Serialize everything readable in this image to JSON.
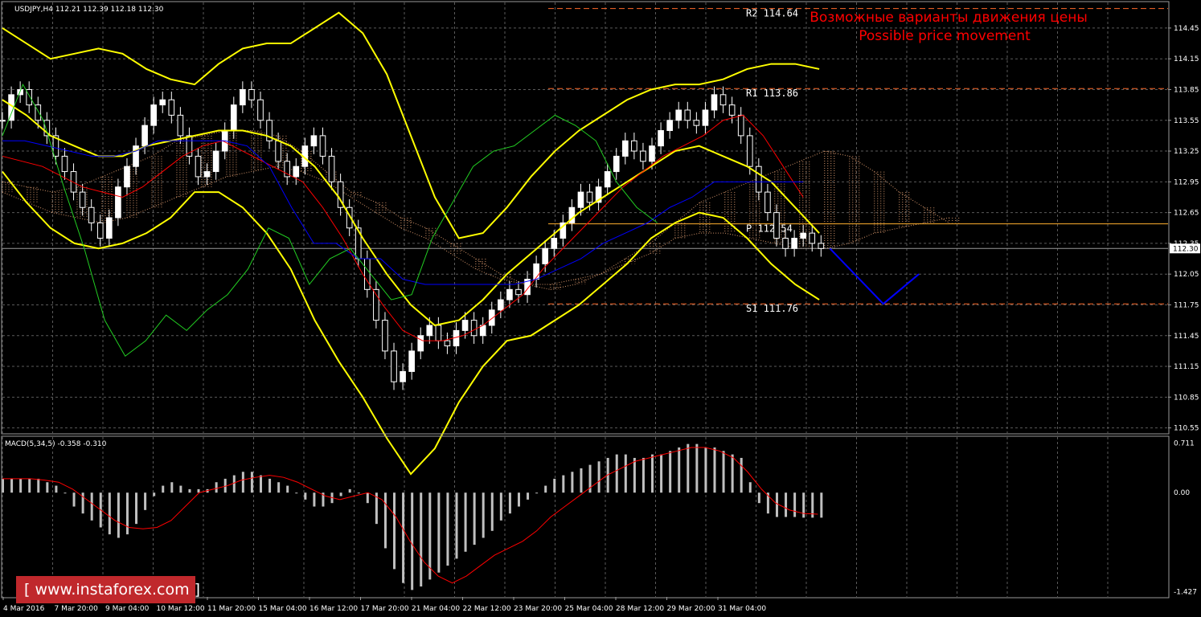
{
  "symbol_info": "USDJPY,H4  112.21 112.39 112.18 112.30",
  "macd_info": "MACD(5,34,5) -0.358 -0.310",
  "annotation": {
    "line1": "Возможные варианты движения цены",
    "line2": "Possible price movement"
  },
  "watermark": "[ www.instaforex.com ]",
  "price_axis": {
    "ticks": [
      "114.45",
      "114.15",
      "113.85",
      "113.55",
      "113.25",
      "112.95",
      "112.65",
      "112.35",
      "112.05",
      "111.75",
      "111.45",
      "111.15",
      "110.85",
      "110.55"
    ],
    "current_price": "112.30"
  },
  "macd_axis": {
    "ticks": [
      "0.711",
      "0.00",
      "-1.427"
    ]
  },
  "time_axis": [
    "4 Mar 2016",
    "7 Mar 20:00",
    "9 Mar 04:00",
    "10 Mar 12:00",
    "11 Mar 20:00",
    "15 Mar 04:00",
    "16 Mar 12:00",
    "17 Mar 20:00",
    "21 Mar 04:00",
    "22 Mar 12:00",
    "23 Mar 20:00",
    "25 Mar 04:00",
    "28 Mar 12:00",
    "29 Mar 20:00",
    "31 Mar 04:00"
  ],
  "levels": [
    {
      "label": "R2 114.64",
      "price": 114.64,
      "color": "#ff6a2a",
      "dash": true
    },
    {
      "label": "R1 113.86",
      "price": 113.86,
      "color": "#ff6a2a",
      "dash": true
    },
    {
      "label": "P 112.54",
      "price": 112.54,
      "color": "#ffb02e",
      "dash": false
    },
    {
      "label": "S1 111.76",
      "price": 111.76,
      "color": "#ff6a2a",
      "dash": true
    }
  ],
  "colors": {
    "background": "#000000",
    "grid": "#5a5a5a",
    "bull": "#ffffff",
    "bear": "#ffffff",
    "bollinger": "#ffff00",
    "tenkan": "#ff0000",
    "kijun": "#0000ff",
    "chikou": "#22cc22",
    "cloud": "#d4956a",
    "forecast": "#0000ff",
    "macd_hist": "#c0c0c0",
    "macd_signal": "#ff0000"
  },
  "chart_data": {
    "type": "line",
    "title": "USDJPY,H4",
    "ylim": [
      110.5,
      114.7
    ],
    "x_range": [
      0,
      131
    ],
    "closes": [
      113.55,
      113.8,
      113.85,
      113.7,
      113.55,
      113.4,
      113.2,
      113.05,
      112.85,
      112.7,
      112.55,
      112.4,
      112.6,
      112.9,
      113.1,
      113.3,
      113.5,
      113.7,
      113.75,
      113.6,
      113.4,
      113.2,
      113.0,
      113.05,
      113.25,
      113.45,
      113.7,
      113.85,
      113.75,
      113.55,
      113.35,
      113.15,
      113.0,
      113.1,
      113.3,
      113.4,
      113.2,
      112.95,
      112.7,
      112.5,
      112.2,
      111.9,
      111.6,
      111.3,
      111.0,
      111.1,
      111.3,
      111.45,
      111.55,
      111.4,
      111.35,
      111.5,
      111.6,
      111.45,
      111.55,
      111.7,
      111.8,
      111.9,
      111.85,
      112.0,
      112.15,
      112.3,
      112.4,
      112.55,
      112.7,
      112.85,
      112.75,
      112.9,
      113.05,
      113.2,
      113.35,
      113.25,
      113.15,
      113.3,
      113.45,
      113.55,
      113.65,
      113.55,
      113.5,
      113.65,
      113.8,
      113.7,
      113.6,
      113.4,
      113.1,
      112.85,
      112.65,
      112.4,
      112.3,
      112.4,
      112.45,
      112.35,
      112.3
    ],
    "ichimoku": {
      "tenkan": [
        113.2,
        113.15,
        113.1,
        113.0,
        112.9,
        112.85,
        112.8,
        112.9,
        113.05,
        113.2,
        113.3,
        113.35,
        113.25,
        113.15,
        113.05,
        112.95,
        112.7,
        112.4,
        112.05,
        111.75,
        111.5,
        111.4,
        111.4,
        111.45,
        111.55,
        111.7,
        111.85,
        112.1,
        112.3,
        112.5,
        112.7,
        112.9,
        113.05,
        113.2,
        113.3,
        113.4,
        113.55,
        113.6,
        113.4,
        113.1,
        112.8
      ],
      "kijun": [
        113.35,
        113.35,
        113.3,
        113.25,
        113.2,
        113.2,
        113.25,
        113.35,
        113.35,
        113.35,
        113.35,
        113.3,
        113.1,
        112.7,
        112.35,
        112.35,
        112.2,
        112.2,
        112.0,
        111.95,
        111.95,
        111.95,
        111.95,
        111.95,
        112.0,
        112.1,
        112.2,
        112.35,
        112.45,
        112.55,
        112.7,
        112.8,
        112.95,
        112.95,
        112.95,
        112.95,
        112.95
      ],
      "senkou_a": [
        112.95,
        112.9,
        112.85,
        112.9,
        113.0,
        113.1,
        113.2,
        113.35,
        113.4,
        113.45,
        113.45,
        113.4,
        113.25,
        113.05,
        112.85,
        112.75,
        112.6,
        112.5,
        112.35,
        112.2,
        112.05,
        111.95,
        111.9,
        111.95,
        112.05,
        112.2,
        112.35,
        112.55,
        112.75,
        112.85,
        112.95,
        113.05,
        113.15,
        113.25,
        113.2,
        113.05,
        112.85,
        112.7,
        112.55
      ],
      "senkou_b": [
        112.85,
        112.75,
        112.65,
        112.6,
        112.55,
        112.6,
        112.7,
        112.8,
        112.9,
        113.0,
        113.05,
        113.1,
        113.05,
        112.95,
        112.8,
        112.65,
        112.5,
        112.4,
        112.25,
        112.1,
        112.0,
        111.95,
        111.95,
        112.0,
        112.05,
        112.15,
        112.25,
        112.4,
        112.45,
        112.45,
        112.4,
        112.35,
        112.3,
        112.3,
        112.35,
        112.45,
        112.5,
        112.55,
        112.6
      ],
      "chikou": [
        113.4,
        113.9,
        113.55,
        112.9,
        112.3,
        111.6,
        111.25,
        111.4,
        111.65,
        111.5,
        111.7,
        111.85,
        112.1,
        112.5,
        112.4,
        111.95,
        112.2,
        112.3,
        112.05,
        111.8,
        111.85,
        112.4,
        112.75,
        113.1,
        113.25,
        113.3,
        113.45,
        113.6,
        113.5,
        113.35,
        112.95,
        112.7,
        112.55
      ]
    },
    "bollinger": {
      "upper": [
        114.45,
        114.3,
        114.15,
        114.2,
        114.25,
        114.2,
        114.05,
        113.95,
        113.9,
        114.1,
        114.25,
        114.3,
        114.3,
        114.45,
        114.6,
        114.4,
        114.0,
        113.4,
        112.8,
        112.4,
        112.45,
        112.7,
        113.0,
        113.25,
        113.45,
        113.6,
        113.75,
        113.85,
        113.9,
        113.9,
        113.95,
        114.05,
        114.1,
        114.1,
        114.05
      ],
      "middle": [
        113.75,
        113.6,
        113.4,
        113.3,
        113.2,
        113.2,
        113.3,
        113.35,
        113.4,
        113.45,
        113.45,
        113.4,
        113.3,
        113.1,
        112.8,
        112.4,
        112.05,
        111.75,
        111.55,
        111.6,
        111.8,
        112.05,
        112.25,
        112.45,
        112.65,
        112.8,
        112.95,
        113.1,
        113.25,
        113.3,
        113.2,
        113.1,
        112.95,
        112.7,
        112.45
      ],
      "lower": [
        113.05,
        112.75,
        112.5,
        112.35,
        112.3,
        112.35,
        112.45,
        112.6,
        112.85,
        112.85,
        112.7,
        112.45,
        112.1,
        111.6,
        111.2,
        110.85,
        110.45,
        110.1,
        110.35,
        110.8,
        111.15,
        111.4,
        111.45,
        111.6,
        111.75,
        111.95,
        112.15,
        112.4,
        112.55,
        112.65,
        112.6,
        112.4,
        112.15,
        111.95,
        111.8
      ]
    },
    "forecast_path": [
      {
        "x": 93,
        "price": 112.3
      },
      {
        "x": 99,
        "price": 111.76
      },
      {
        "x": 103,
        "price": 112.05
      }
    ],
    "macd": {
      "ylim": [
        -1.5,
        0.8
      ],
      "histogram": [
        0.2,
        0.2,
        0.2,
        0.2,
        0.2,
        0.15,
        0.1,
        0.0,
        -0.2,
        -0.3,
        -0.4,
        -0.5,
        -0.6,
        -0.65,
        -0.6,
        -0.45,
        -0.25,
        -0.05,
        0.1,
        0.15,
        0.1,
        0.05,
        0.05,
        0.05,
        0.15,
        0.2,
        0.25,
        0.3,
        0.3,
        0.25,
        0.2,
        0.15,
        0.1,
        0.0,
        -0.1,
        -0.2,
        -0.2,
        -0.15,
        -0.05,
        0.05,
        0.0,
        -0.15,
        -0.45,
        -0.8,
        -1.1,
        -1.3,
        -1.4,
        -1.35,
        -1.25,
        -1.15,
        -1.05,
        -0.95,
        -0.85,
        -0.75,
        -0.65,
        -0.55,
        -0.4,
        -0.3,
        -0.2,
        -0.1,
        0.0,
        0.1,
        0.2,
        0.25,
        0.3,
        0.35,
        0.4,
        0.45,
        0.5,
        0.55,
        0.55,
        0.5,
        0.5,
        0.55,
        0.55,
        0.6,
        0.65,
        0.7,
        0.7,
        0.65,
        0.65,
        0.6,
        0.55,
        0.5,
        0.15,
        -0.15,
        -0.3,
        -0.35,
        -0.35,
        -0.35,
        -0.36,
        -0.36,
        -0.36
      ],
      "signal": [
        0.2,
        0.2,
        0.2,
        0.18,
        0.15,
        0.05,
        -0.1,
        -0.25,
        -0.4,
        -0.5,
        -0.52,
        -0.5,
        -0.4,
        -0.2,
        0.0,
        0.05,
        0.1,
        0.18,
        0.22,
        0.25,
        0.22,
        0.15,
        0.05,
        -0.05,
        -0.1,
        -0.05,
        0.0,
        -0.1,
        -0.35,
        -0.7,
        -1.0,
        -1.2,
        -1.3,
        -1.2,
        -1.05,
        -0.9,
        -0.8,
        -0.7,
        -0.55,
        -0.35,
        -0.2,
        -0.05,
        0.1,
        0.25,
        0.35,
        0.45,
        0.5,
        0.55,
        0.6,
        0.65,
        0.65,
        0.6,
        0.5,
        0.3,
        0.05,
        -0.15,
        -0.25,
        -0.3,
        -0.31
      ]
    }
  }
}
